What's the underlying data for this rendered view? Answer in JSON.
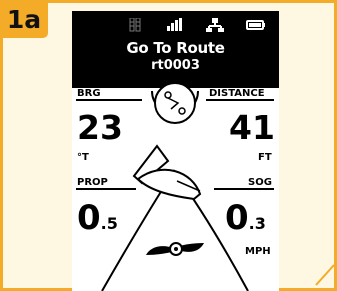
{
  "figure_tag": "1a",
  "status": {
    "icons": [
      "battery-icon",
      "signal-bars-icon",
      "network-icon",
      "battery-level-icon"
    ]
  },
  "header": {
    "title": "Go To Route",
    "route_name": "rt0003"
  },
  "bearing": {
    "label": "BRG",
    "value": "23",
    "unit": "°T"
  },
  "distance": {
    "label": "DISTANCE",
    "value": "41",
    "unit": "FT"
  },
  "prop": {
    "label": "PROP",
    "whole": "0",
    "decimal": ".5"
  },
  "sog": {
    "label": "SOG",
    "whole": "0",
    "decimal": ".3",
    "unit": "MPH"
  },
  "colors": {
    "frame_border": "#f4ab28",
    "frame_background": "#fef7e1",
    "screen_background": "#ffffff",
    "header_background": "#000000"
  }
}
